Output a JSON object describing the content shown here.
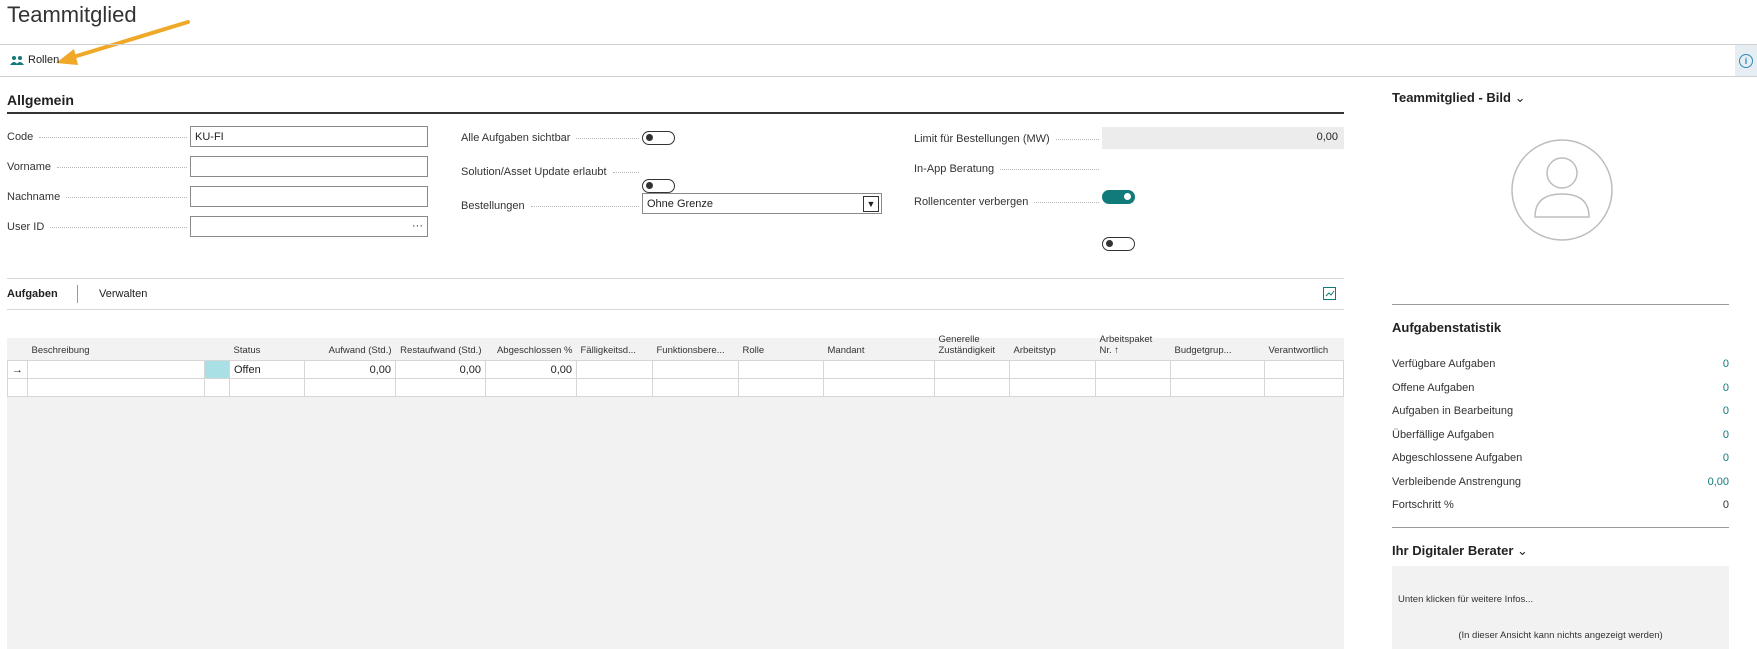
{
  "page": {
    "title": "Teammitglied"
  },
  "actionbar": {
    "roles_label": "Rollen",
    "info_label": "i"
  },
  "general": {
    "heading": "Allgemein",
    "code_label": "Code",
    "code_value": "KU-FI",
    "firstname_label": "Vorname",
    "firstname_value": "",
    "lastname_label": "Nachname",
    "lastname_value": "",
    "userid_label": "User ID",
    "userid_value": "",
    "userid_ellipsis": "···",
    "all_tasks_label": "Alle Aufgaben sichtbar",
    "all_tasks_on": false,
    "solution_update_label": "Solution/Asset Update erlaubt",
    "solution_update_on": false,
    "orders_label": "Bestellungen",
    "orders_value": "Ohne Grenze",
    "limit_label": "Limit für Bestellungen (MW)",
    "limit_value": "0,00",
    "inapp_label": "In-App Beratung",
    "inapp_on": true,
    "hide_rolecenter_label": "Rollencenter verbergen",
    "hide_rolecenter_on": false
  },
  "tasks": {
    "tabs": [
      "Aufgaben",
      "Verwalten"
    ],
    "columns": [
      "Beschreibung",
      "Status",
      "Aufwand (Std.)",
      "Restaufwand (Std.)",
      "Abgeschlossen %",
      "Fälligkeitsd...",
      "Funktionsbere...",
      "Rolle",
      "Mandant",
      "Generelle Zuständigkeit",
      "Arbeitstyp",
      "Arbeitspaket Nr. ↑",
      "Budgetgrup...",
      "Verantwortlich"
    ],
    "row1": {
      "marker": "→",
      "status": "Offen",
      "effort": "0,00",
      "remaining": "0,00",
      "completed": "0,00"
    }
  },
  "picture_panel": {
    "heading": "Teammitglied - Bild"
  },
  "stats": {
    "heading": "Aufgabenstatistik",
    "rows": [
      {
        "label": "Verfügbare Aufgaben",
        "value": "0"
      },
      {
        "label": "Offene Aufgaben",
        "value": "0"
      },
      {
        "label": "Aufgaben in Bearbeitung",
        "value": "0"
      },
      {
        "label": "Überfällige Aufgaben",
        "value": "0"
      },
      {
        "label": "Abgeschlossene Aufgaben",
        "value": "0"
      },
      {
        "label": "Verbleibende Anstrengung",
        "value": "0,00"
      },
      {
        "label": "Fortschritt %",
        "value": "0"
      }
    ]
  },
  "advisor": {
    "heading": "Ihr Digitaler Berater",
    "hint": "Unten klicken für weitere Infos...",
    "empty_note": "(In dieser Ansicht kann nichts angezeigt werden)"
  },
  "colors": {
    "accent": "#117a7a",
    "arrow": "#f0a829",
    "marker_cell": "#a8e0e6"
  }
}
